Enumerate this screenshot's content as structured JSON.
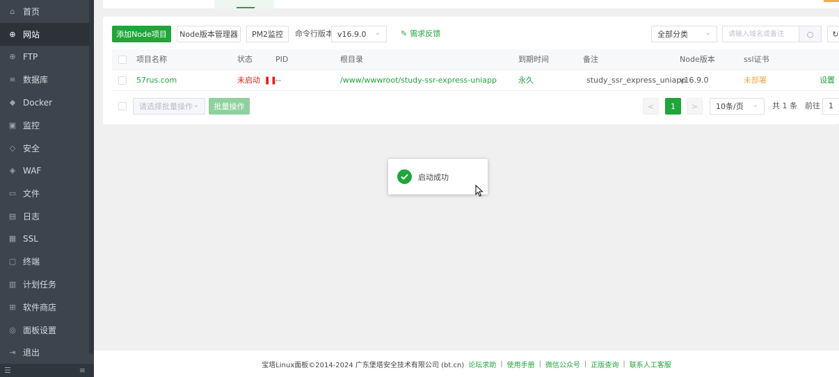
{
  "sidebar": {
    "items": [
      {
        "icon": "home-icon",
        "glyph": "⌂",
        "label": "首页"
      },
      {
        "icon": "globe-icon",
        "glyph": "⊕",
        "label": "网站"
      },
      {
        "icon": "ftp-globe-icon",
        "glyph": "⊕",
        "label": "FTP"
      },
      {
        "icon": "database-icon",
        "glyph": "≡",
        "label": "数据库"
      },
      {
        "icon": "docker-icon",
        "glyph": "◆",
        "label": "Docker"
      },
      {
        "icon": "monitor-icon",
        "glyph": "▣",
        "label": "监控"
      },
      {
        "icon": "shield-icon",
        "glyph": "◇",
        "label": "安全"
      },
      {
        "icon": "waf-shield-icon",
        "glyph": "◈",
        "label": "WAF"
      },
      {
        "icon": "folder-icon",
        "glyph": "▭",
        "label": "文件"
      },
      {
        "icon": "log-icon",
        "glyph": "▤",
        "label": "日志"
      },
      {
        "icon": "ssl-icon",
        "glyph": "▦",
        "label": "SSL"
      },
      {
        "icon": "terminal-icon",
        "glyph": "▢",
        "label": "终端"
      },
      {
        "icon": "cron-icon",
        "glyph": "▥",
        "label": "计划任务"
      },
      {
        "icon": "store-icon",
        "glyph": "⊞",
        "label": "软件商店"
      },
      {
        "icon": "settings-icon",
        "glyph": "◎",
        "label": "面板设置"
      },
      {
        "icon": "logout-icon",
        "glyph": "⇥",
        "label": "退出"
      }
    ],
    "bottom_left_glyph": "☰",
    "bottom_right_glyph": "≡"
  },
  "toolbar": {
    "add_label": "添加Node项目",
    "version_manager_label": "Node版本管理器",
    "pm2_label": "PM2监控",
    "cli_version_label": "命令行版本",
    "cli_version_value": "v16.9.0",
    "feedback_label": "需求反馈",
    "category_value": "全部分类",
    "search_placeholder": "请输入域名或备注"
  },
  "table": {
    "headers": [
      "项目名称",
      "状态",
      "PID",
      "根目录",
      "到期时间",
      "备注",
      "Node版本",
      "ssl证书"
    ],
    "rows": [
      {
        "name": "57rus.com",
        "status": "未启动",
        "pid": "--",
        "root": "/www/wwwroot/study-ssr-express-uniapp",
        "expire": "永久",
        "note": "study_ssr_express_uniapp",
        "node_version": "v16.9.0",
        "ssl": "未部署",
        "action": "设置"
      }
    ]
  },
  "footer_bar": {
    "batch_placeholder": "请选择批量操作",
    "batch_button": "批量操作",
    "prev": "<",
    "current_page": "1",
    "next": ">",
    "per_page": "10条/页",
    "total": "共 1 条",
    "goto": "前往",
    "goto_value": "1"
  },
  "toast": {
    "message": "启动成功"
  },
  "page_footer": {
    "copyright": "宝塔Linux面板©2014-2024 广东堡塔安全技术有限公司 (bt.cn)",
    "links": [
      "论坛求助",
      "使用手册",
      "微信公众号",
      "正版查询",
      "联系人工客服"
    ]
  },
  "colors": {
    "accent": "#20a53a",
    "sidebar_bg": "#3c444d",
    "danger": "#e02020",
    "warning": "#f0ad4e"
  }
}
